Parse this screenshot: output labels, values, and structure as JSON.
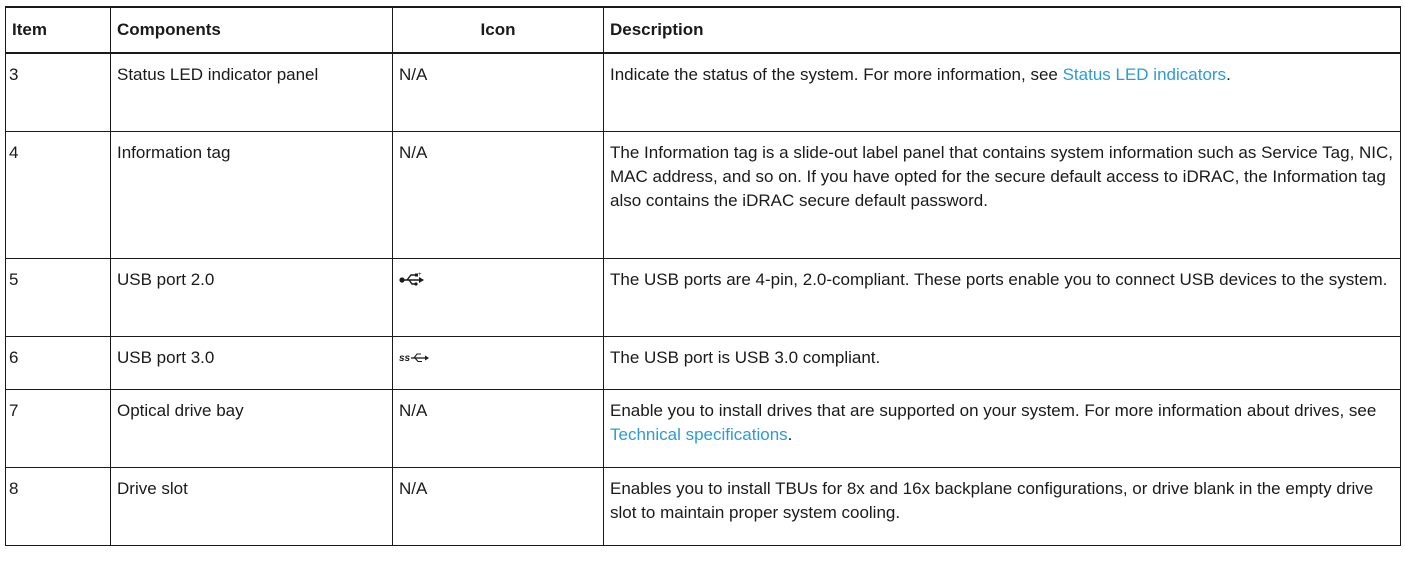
{
  "table": {
    "headers": {
      "item": "Item",
      "components": "Components",
      "icon": "Icon",
      "description": "Description"
    },
    "rows": [
      {
        "item": "3",
        "component": "Status LED indicator panel",
        "icon_text": "N/A",
        "description": "Indicate the status of the system. For more information, see ",
        "link": "Status LED indicators",
        "description_after": "."
      },
      {
        "item": "4",
        "component": "Information tag",
        "icon_text": "N/A",
        "description": "The Information tag is a slide-out label panel that contains system information such as Service Tag, NIC, MAC address, and so on. If you have opted for the secure default access to iDRAC, the Information tag also contains the iDRAC secure default password."
      },
      {
        "item": "5",
        "component": "USB port 2.0",
        "icon": "usb-2-icon",
        "description": "The USB ports are 4-pin, 2.0-compliant. These ports enable you to connect USB devices to the system."
      },
      {
        "item": "6",
        "component": "USB port 3.0",
        "icon": "usb-3-superspeed-icon",
        "description": "The USB port is USB 3.0 compliant."
      },
      {
        "item": "7",
        "component": "Optical drive bay",
        "icon_text": "N/A",
        "description": "Enable you to install drives that are supported on your system. For more information about drives, see ",
        "link": "Technical specifications",
        "description_after": "."
      },
      {
        "item": "8",
        "component": "Drive slot",
        "icon_text": "N/A",
        "description": "Enables you to install TBUs for 8x and 16x backplane configurations, or drive blank in the empty drive slot to maintain proper system cooling."
      }
    ]
  },
  "colors": {
    "link": "#2d9cd6",
    "text": "#1a1a1a",
    "border": "#1a1a1a"
  }
}
